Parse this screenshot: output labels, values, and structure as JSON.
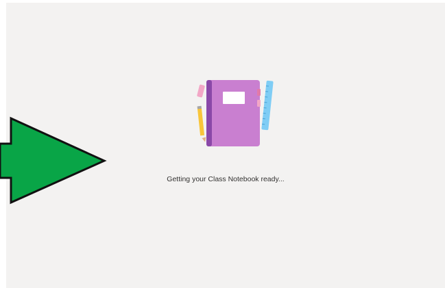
{
  "loading": {
    "status_text": "Getting your Class Notebook ready..."
  },
  "illustration": {
    "icon_name": "class-notebook-icon",
    "colors": {
      "notebook_cover": "#c97fd0",
      "notebook_spine": "#8a48a8",
      "notebook_label": "#ffffff",
      "pencil": "#f8c53a",
      "ruler": "#7fcdf5",
      "eraser": "#f2a7c6"
    }
  },
  "overlay": {
    "icon_name": "arrow-right-icon",
    "color": "#09a547"
  },
  "colors": {
    "background": "#f3f2f1",
    "text": "#323130"
  }
}
